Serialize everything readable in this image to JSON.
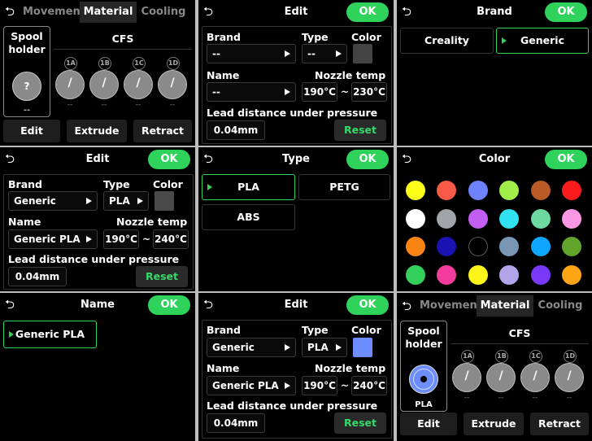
{
  "material_tabs": [
    "Movement",
    "Material",
    "Cooling"
  ],
  "spool_holder": {
    "title_line1": "Spool",
    "title_line2": "holder",
    "empty_value": "--",
    "filled_value": "PLA",
    "empty_symbol": "?"
  },
  "cfs": {
    "title": "CFS",
    "slots": [
      "1A",
      "1B",
      "1C",
      "1D"
    ],
    "slot_symbol": "/",
    "slot_value": "--"
  },
  "actions": {
    "edit": "Edit",
    "extrude": "Extrude",
    "retract": "Retract"
  },
  "edit_form": {
    "title": "Edit",
    "ok": "OK",
    "brand_label": "Brand",
    "type_label": "Type",
    "color_label": "Color",
    "name_label": "Name",
    "nozzle_label": "Nozzle temp",
    "lead_label": "Lead distance under pressure",
    "reset": "Reset",
    "tilde": "~",
    "empty": {
      "brand": "--",
      "type": "--",
      "name": "--",
      "temp_min": "190°C",
      "temp_max": "230°C",
      "lead": "0.04mm",
      "color": "#444444"
    },
    "generic_grey": {
      "brand": "Generic",
      "type": "PLA",
      "name": "Generic PLA",
      "temp_min": "190°C",
      "temp_max": "240°C",
      "lead": "0.04mm",
      "color": "#4a4a4a"
    },
    "generic_blue": {
      "brand": "Generic",
      "type": "PLA",
      "name": "Generic PLA",
      "temp_min": "190°C",
      "temp_max": "240°C",
      "lead": "0.04mm",
      "color": "#6e8dfd"
    }
  },
  "name_screen": {
    "title": "Name",
    "ok": "OK",
    "items": [
      "Generic PLA"
    ]
  },
  "type_screen": {
    "title": "Type",
    "items": [
      "PLA",
      "PETG",
      "ABS"
    ]
  },
  "brand_screen": {
    "title": "Brand",
    "ok": "OK",
    "items": [
      "Creality",
      "Generic"
    ]
  },
  "color_screen": {
    "title": "Color",
    "ok": "OK",
    "colors": [
      "#fdfd1a",
      "#f75a47",
      "#6f82fd",
      "#a1ee4b",
      "#b95a27",
      "#fa1c1c",
      "#ffffff",
      "#9ea4a7",
      "#c25ff3",
      "#30e1f1",
      "#6dd89f",
      "#fb97e3",
      "#fa8413",
      "#1b13b1",
      "#000000",
      "#7996b4",
      "#0fa6ff",
      "#62a42a",
      "#33d15b",
      "#f33a9d",
      "#fdf419",
      "#b3a3e9",
      "#7a38f7",
      "#fea415"
    ]
  }
}
